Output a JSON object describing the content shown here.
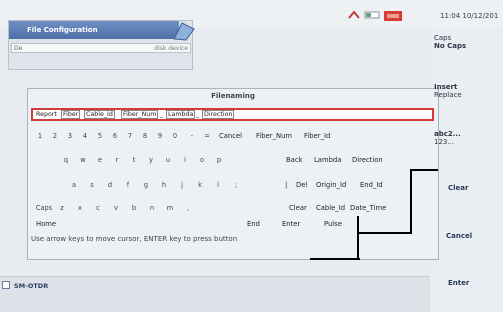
{
  "status_bar": {
    "time": "11:04 10/12/201"
  },
  "file_config": {
    "title": "File Configuration",
    "field_left": "De",
    "field_right": "disk device"
  },
  "dialog": {
    "title": "Filenaming",
    "filename_segments": [
      "Report",
      "Fiber",
      "Cable_Id",
      "Fiber_Num",
      "_",
      "Lambda",
      "_",
      "Direction"
    ],
    "keys_row1": [
      "1",
      "2",
      "3",
      "4",
      "5",
      "6",
      "7",
      "8",
      "9",
      "0",
      "-",
      "="
    ],
    "keys_row2": [
      "q",
      "w",
      "e",
      "r",
      "t",
      "y",
      "u",
      "i",
      "o",
      "p"
    ],
    "keys_row3": [
      "a",
      "s",
      "d",
      "f",
      "g",
      "h",
      "j",
      "k",
      "l",
      ";"
    ],
    "keys_row4": [
      "Caps",
      "z",
      "x",
      "c",
      "v",
      "b",
      "n",
      "m",
      ","
    ],
    "home": "Home",
    "end": "End",
    "enter": "Enter",
    "pulse": "Pulse",
    "cancel": "Cancel",
    "fiber_num": "Fiber_Num",
    "fiber_id": "Fiber_Id",
    "back": "Back",
    "lambda": "Lambda",
    "direction": "Direction",
    "bar": "|",
    "del": "Del",
    "origin_id": "Origin_Id",
    "end_id": "End_Id",
    "clear": "Clear",
    "cable_id": "Cable_Id",
    "date_time": "Date_Time",
    "hint": "Use arrow keys to move cursor, ENTER key to press button"
  },
  "right_panel": {
    "caps": "Caps",
    "no_caps": "No Caps",
    "insert": "Insert",
    "replace": "Replace",
    "abc": "abc2...",
    "num": "123...",
    "clear": "Clear",
    "cancel": "Cancel",
    "enter": "Enter"
  },
  "bottom": {
    "item": "SM-OTDR"
  }
}
